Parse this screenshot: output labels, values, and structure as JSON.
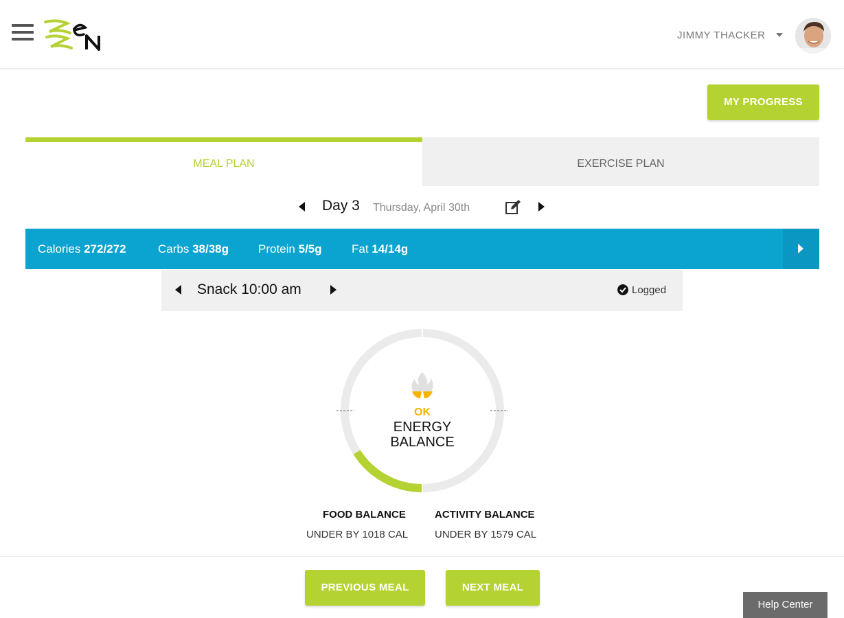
{
  "header": {
    "user_name": "JIMMY THACKER"
  },
  "progress_button": "MY PROGRESS",
  "tabs": [
    {
      "label": "MEAL PLAN",
      "active": true
    },
    {
      "label": "EXERCISE PLAN",
      "active": false
    }
  ],
  "day": {
    "label": "Day 3",
    "date": "Thursday, April 30th"
  },
  "macros": [
    {
      "name": "Calories",
      "value": "272/272"
    },
    {
      "name": "Carbs",
      "value": "38/38g"
    },
    {
      "name": "Protein",
      "value": "5/5g"
    },
    {
      "name": "Fat",
      "value": "14/14g"
    }
  ],
  "meal": {
    "label": "Snack 10:00 am",
    "status": "Logged"
  },
  "energy": {
    "status": "OK",
    "title_line1": "ENERGY",
    "title_line2": "BALANCE",
    "ring_fill_fraction": 0.16
  },
  "food_balance": {
    "title": "FOOD BALANCE",
    "value": "UNDER BY 1018 CAL"
  },
  "activity_balance": {
    "title": "ACTIVITY BALANCE",
    "value": "UNDER BY 1579 CAL"
  },
  "footer": {
    "prev_label": "PREVIOUS MEAL",
    "next_label": "NEXT MEAL"
  },
  "help_label": "Help Center",
  "colors": {
    "brand_green": "#b5d233",
    "macro_blue": "#0ba3d0",
    "ok_yellow": "#f4b400"
  }
}
